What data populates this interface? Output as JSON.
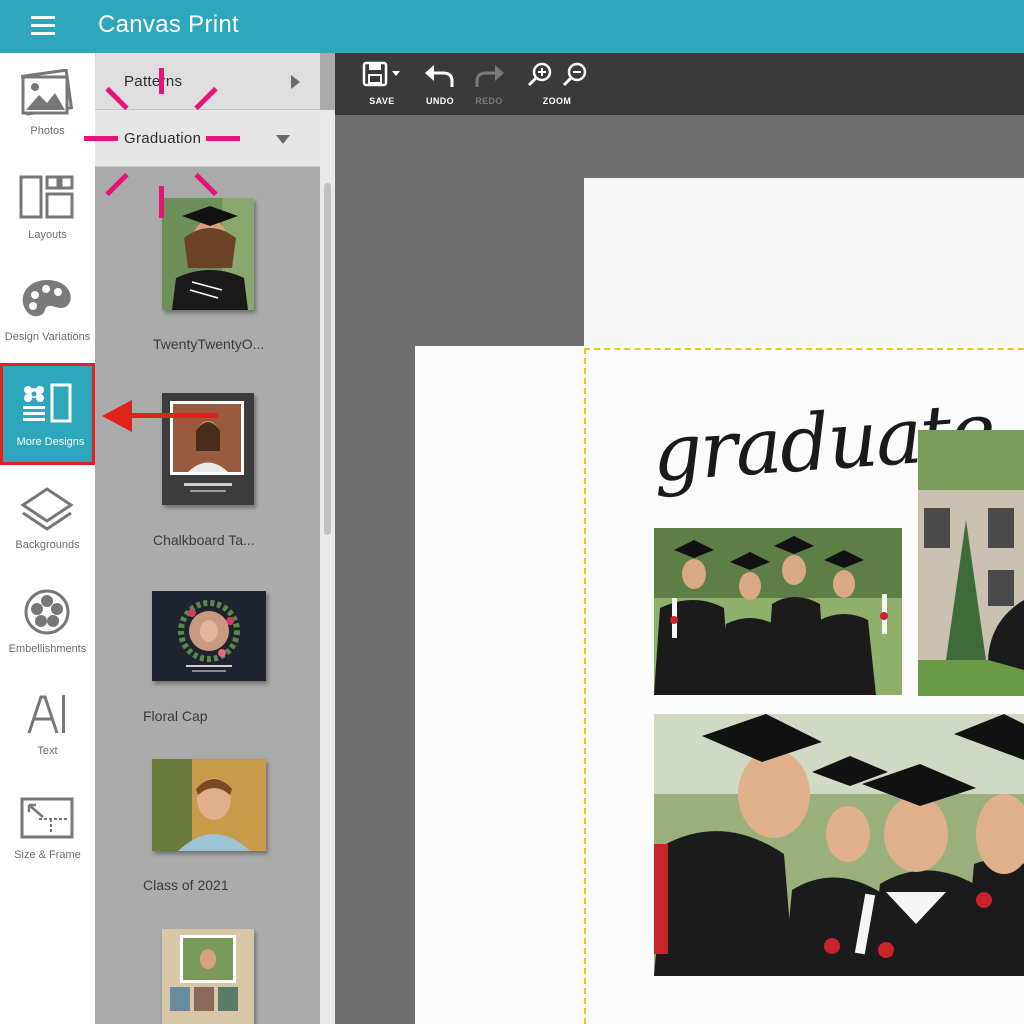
{
  "app": {
    "title": "Canvas Print"
  },
  "rail": {
    "items": [
      {
        "label": "Photos",
        "icon": "photos-icon"
      },
      {
        "label": "Layouts",
        "icon": "layouts-icon"
      },
      {
        "label": "Design Variations",
        "icon": "palette-icon"
      },
      {
        "label": "More Designs",
        "icon": "more-designs-icon",
        "active": true
      },
      {
        "label": "Backgrounds",
        "icon": "backgrounds-icon"
      },
      {
        "label": "Embellishments",
        "icon": "flower-icon"
      },
      {
        "label": "Text",
        "icon": "text-icon"
      },
      {
        "label": "Size & Frame",
        "icon": "size-frame-icon"
      }
    ]
  },
  "panel": {
    "categories": [
      {
        "label": "Patterns",
        "state": "collapsed"
      },
      {
        "label": "Graduation",
        "state": "expanded"
      }
    ],
    "designs": [
      {
        "label": "TwentyTwentyO..."
      },
      {
        "label": "Chalkboard Ta..."
      },
      {
        "label": "Floral Cap"
      },
      {
        "label": "Class of 2021"
      },
      {
        "label": ""
      }
    ]
  },
  "toolbar": {
    "save": "SAVE",
    "undo": "UNDO",
    "redo": "REDO",
    "zoom": "ZOOM"
  },
  "canvas": {
    "headline": "graduate"
  },
  "colors": {
    "brand": "#2ea7bd",
    "highlight_border": "#e0221c",
    "callout": "#e6137a",
    "selection": "#f0c419"
  }
}
